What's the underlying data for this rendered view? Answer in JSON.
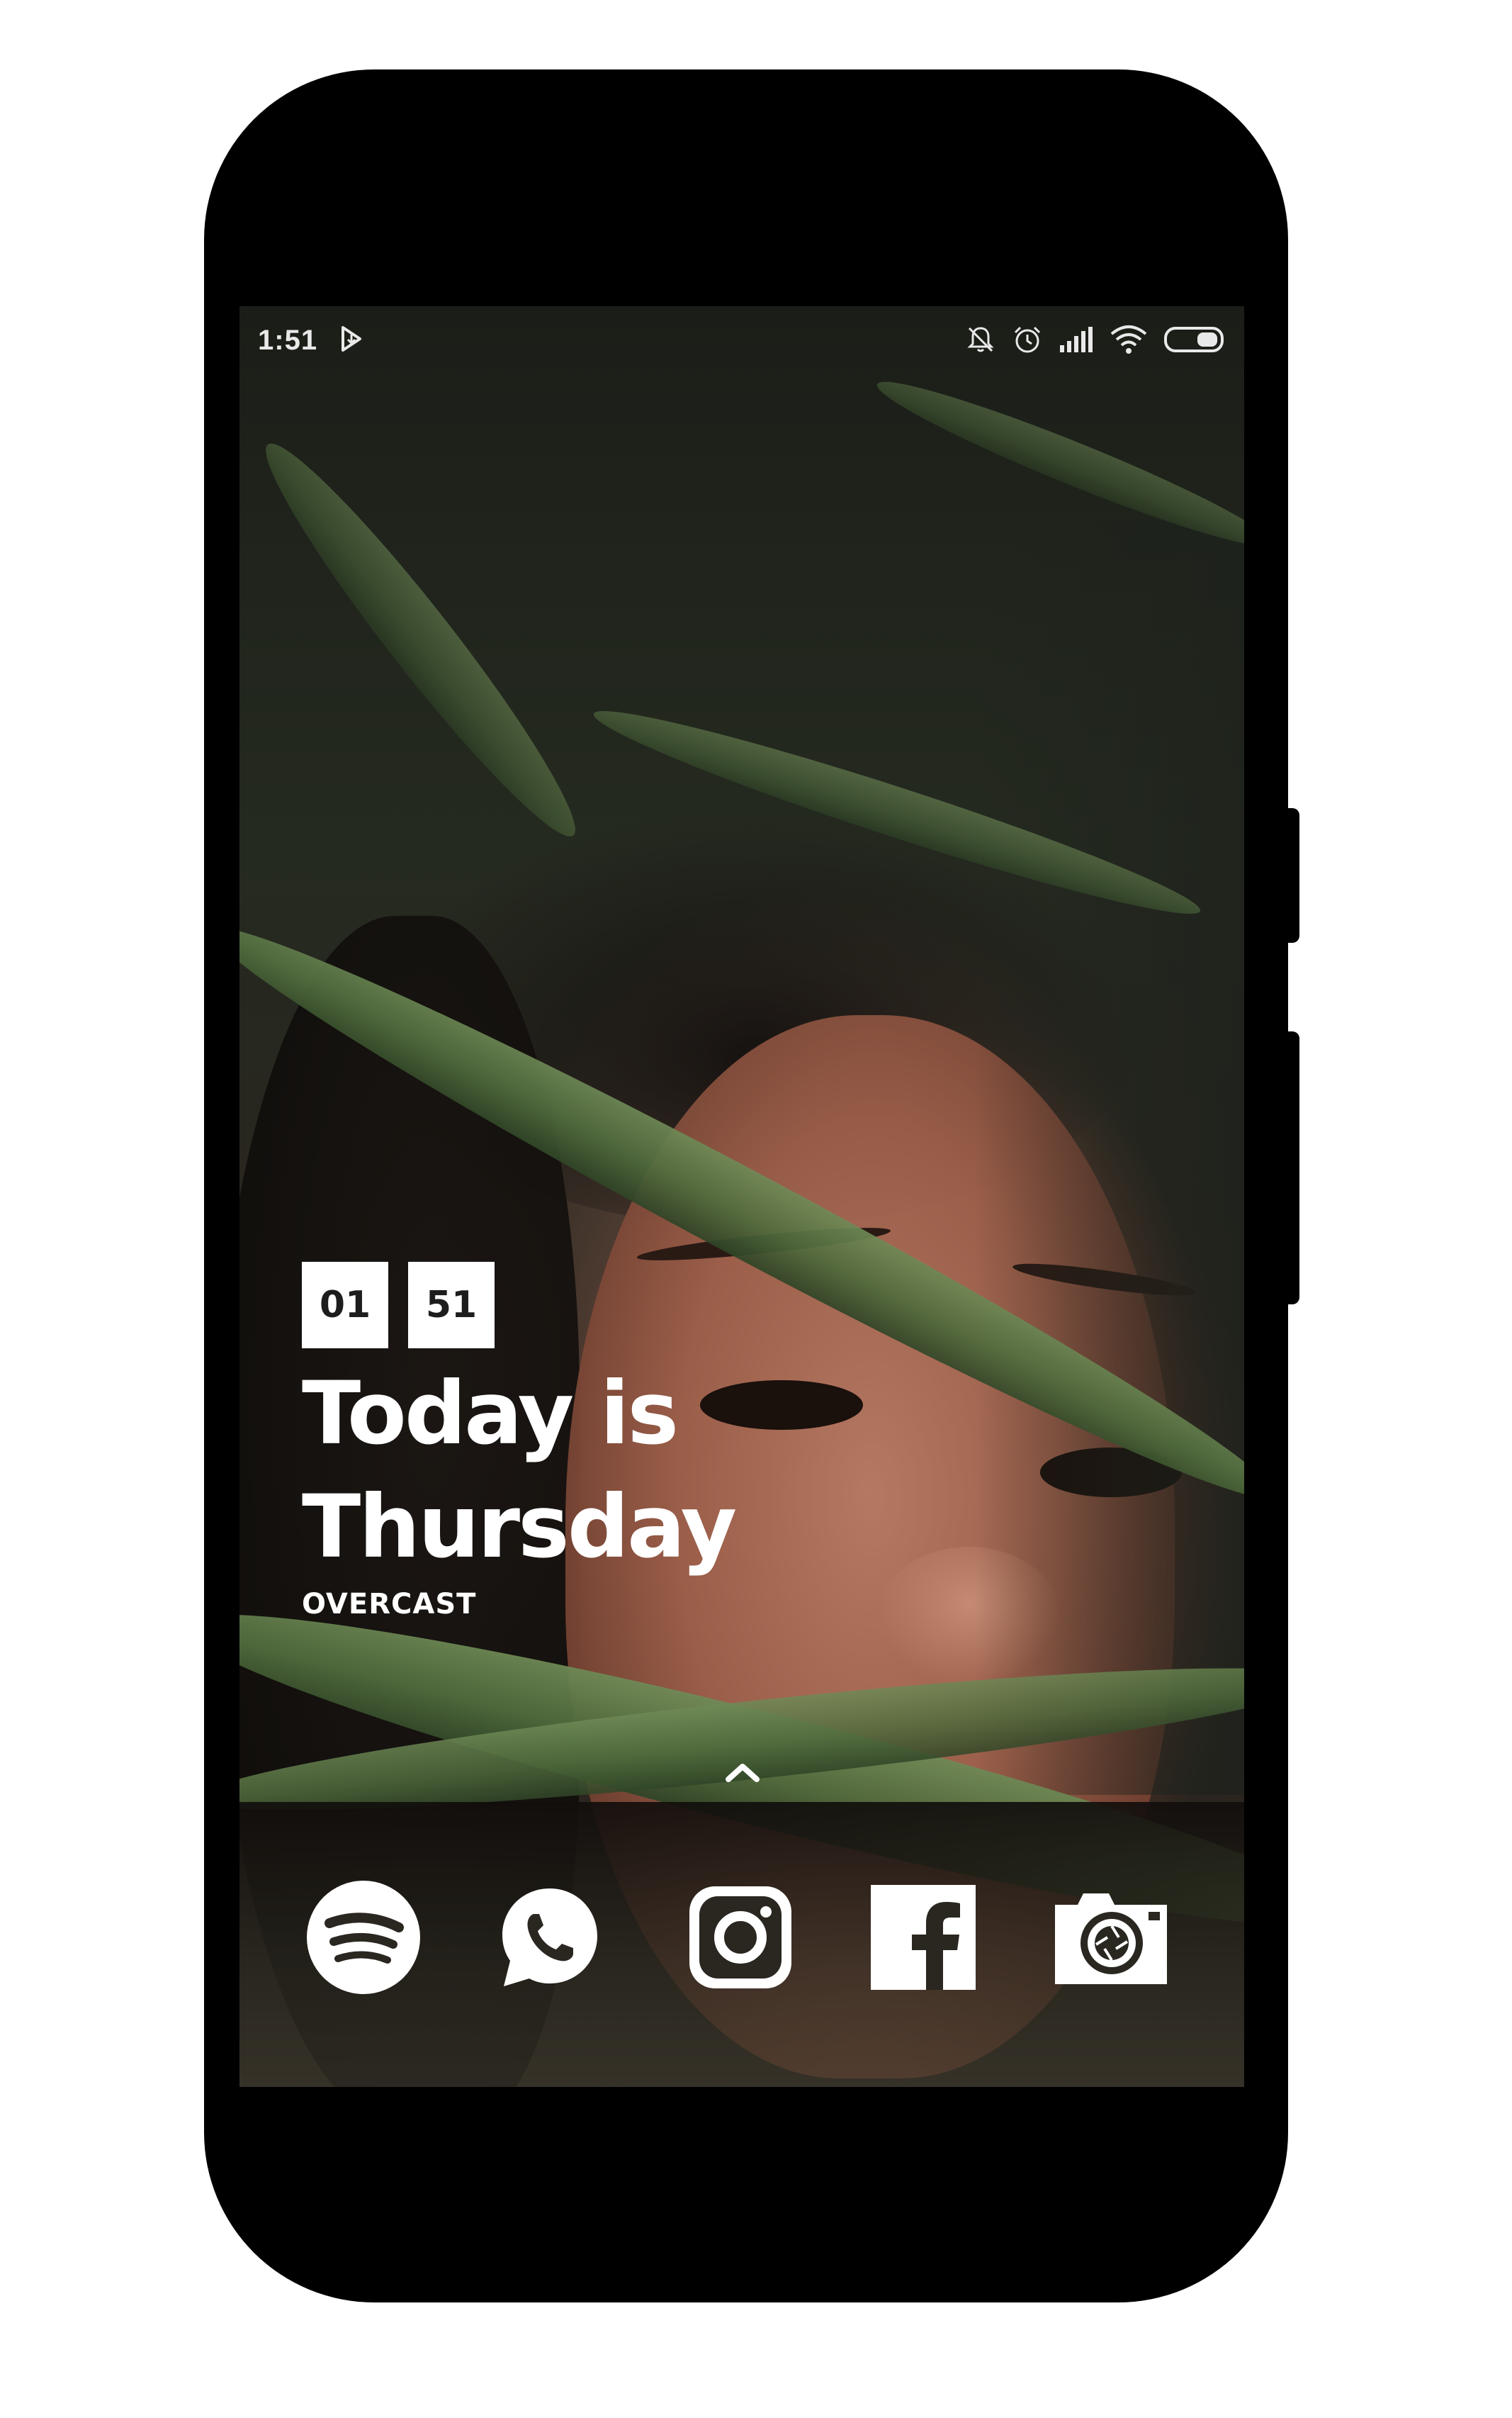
{
  "status_bar": {
    "time": "1:51",
    "left_icons": [
      "play-store-download-icon"
    ],
    "right_icons": [
      "bell-off-icon",
      "alarm-clock-icon",
      "signal-icon",
      "wifi-icon",
      "battery-icon"
    ]
  },
  "widget": {
    "clock_hours": "01",
    "clock_minutes": "51",
    "headline_line1": "Today is",
    "headline_line2": "Thursday",
    "weather": "OVERCAST"
  },
  "dock": {
    "apps": [
      {
        "name": "Spotify",
        "icon": "spotify-icon"
      },
      {
        "name": "WhatsApp",
        "icon": "whatsapp-icon"
      },
      {
        "name": "Instagram",
        "icon": "instagram-icon"
      },
      {
        "name": "Facebook",
        "icon": "facebook-icon"
      },
      {
        "name": "Camera",
        "icon": "camera-icon"
      }
    ]
  },
  "colors": {
    "frame": "#000000",
    "widget_text": "#ffffff",
    "clock_box_bg": "#ffffff",
    "clock_box_text": "#1d1d1d",
    "status_text": "#e9e9e9"
  }
}
